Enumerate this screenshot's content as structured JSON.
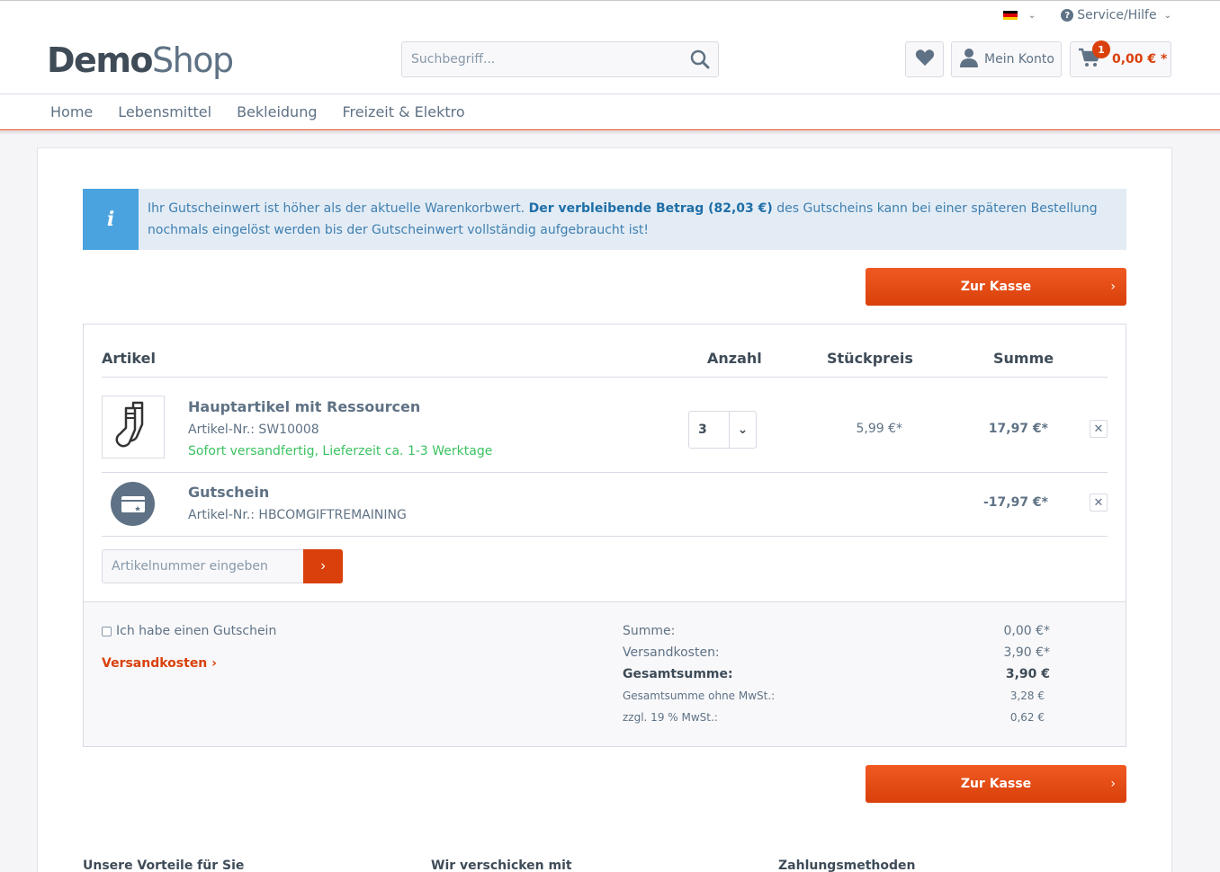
{
  "header": {
    "logo_bold": "Demo",
    "logo_light": "Shop",
    "service_label": "Service/Hilfe",
    "search_placeholder": "Suchbegriff...",
    "account_label": "Mein Konto",
    "cart_amount": "0,00 € *",
    "cart_badge": "1"
  },
  "nav": {
    "items": [
      "Home",
      "Lebensmittel",
      "Bekleidung",
      "Freizeit & Elektro"
    ]
  },
  "alert": {
    "icon": "i",
    "text_before": "Ihr Gutscheinwert ist höher als der aktuelle Warenkorbwert. ",
    "text_bold": "Der verbleibende Betrag (82,03 €)",
    "text_after": " des Gutscheins kann bei einer späteren Bestellung nochmals eingelöst werden bis der Gutscheinwert vollständig aufgebraucht ist!"
  },
  "checkout_label": "Zur Kasse",
  "table": {
    "headers": {
      "article": "Artikel",
      "qty": "Anzahl",
      "unit_price": "Stückpreis",
      "sum": "Summe"
    },
    "items": [
      {
        "name": "Hauptartikel mit Ressourcen",
        "number": "Artikel-Nr.: SW10008",
        "delivery": "Sofort versandfertig, Lieferzeit ca. 1-3 Werktage",
        "qty": "3",
        "unit_price": "5,99 €*",
        "sum": "17,97 €*",
        "icon": "socks-icon"
      },
      {
        "name": "Gutschein",
        "number": "Artikel-Nr.: HBCOMGIFTREMAINING",
        "sum": "-17,97 €*",
        "icon": "voucher-icon"
      }
    ],
    "add_placeholder": "Artikelnummer eingeben",
    "add_button": "›"
  },
  "summary": {
    "voucher_label": "Ich habe einen Gutschein",
    "shipping_link": "Versandkosten",
    "lines": [
      {
        "label": "Summe:",
        "value": "0,00 €*"
      },
      {
        "label": "Versandkosten:",
        "value": "3,90 €*"
      },
      {
        "label": "Gesamtsumme:",
        "value": "3,90 €"
      },
      {
        "label": "Gesamtsumme ohne MwSt.:",
        "value": "3,28 €"
      },
      {
        "label": "zzgl. 19 % MwSt.:",
        "value": "0,62 €"
      }
    ]
  },
  "footer": {
    "headings": [
      "Unsere Vorteile für Sie",
      "Wir verschicken mit",
      "Zahlungsmethoden"
    ]
  },
  "colors": {
    "accent": "#d9400b",
    "info": "#4aa3df",
    "success": "#3cc261"
  }
}
